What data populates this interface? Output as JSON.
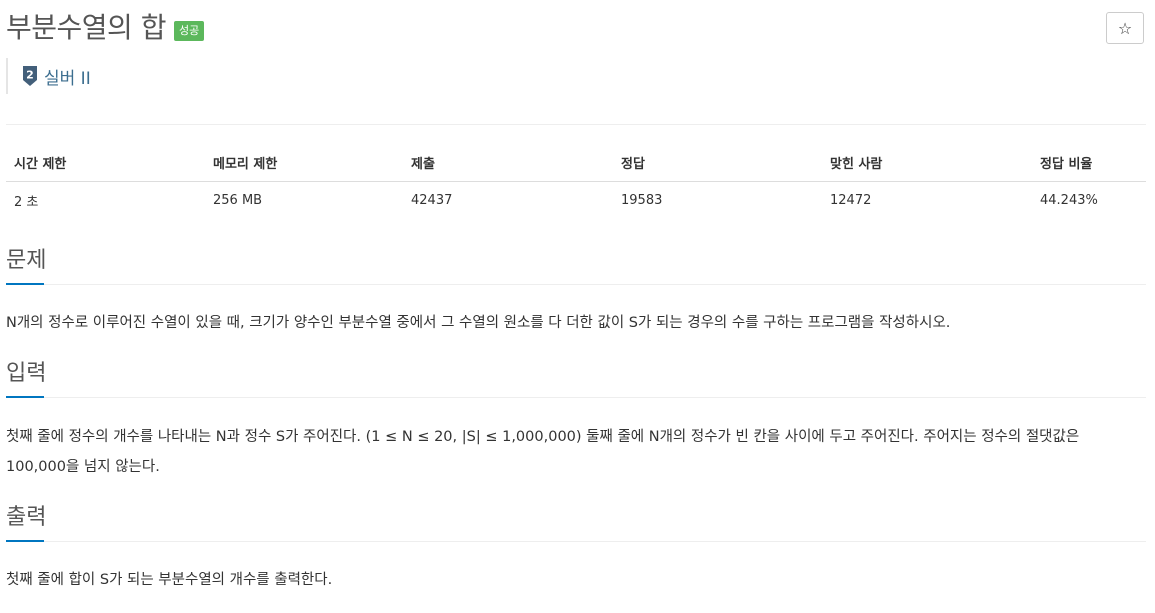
{
  "problem": {
    "title": "부분수열의 합",
    "status_badge": "성공",
    "star_glyph": "☆",
    "tier_number": "2",
    "tier_label": "실버 II",
    "tier_color": "#435f7a"
  },
  "info_table": {
    "headers": [
      "시간 제한",
      "메모리 제한",
      "제출",
      "정답",
      "맞힌 사람",
      "정답 비율"
    ],
    "values": [
      "2 초",
      "256 MB",
      "42437",
      "19583",
      "12472",
      "44.243%"
    ]
  },
  "sections": {
    "problem": {
      "heading": "문제",
      "text": "N개의 정수로 이루어진 수열이 있을 때, 크기가 양수인 부분수열 중에서 그 수열의 원소를 다 더한 값이 S가 되는 경우의 수를 구하는 프로그램을 작성하시오."
    },
    "input": {
      "heading": "입력",
      "line1": "첫째 줄에 정수의 개수를 나타내는 N과 정수 S가 주어진다. (1 ≤ N ≤ 20, |S| ≤ 1,000,000) 둘째 줄에 N개의 정수가 빈 칸을 사이에 두고 주어진다. 주어지는 정수의 절댓값은",
      "line2": "100,000을 넘지 않는다."
    },
    "output": {
      "heading": "출력",
      "text": "첫째 줄에 합이 S가 되는 부분수열의 개수를 출력한다."
    }
  },
  "colors": {
    "accent": "#0076c0",
    "success": "#5cb85c",
    "tier_text": "#3c6e8f"
  }
}
